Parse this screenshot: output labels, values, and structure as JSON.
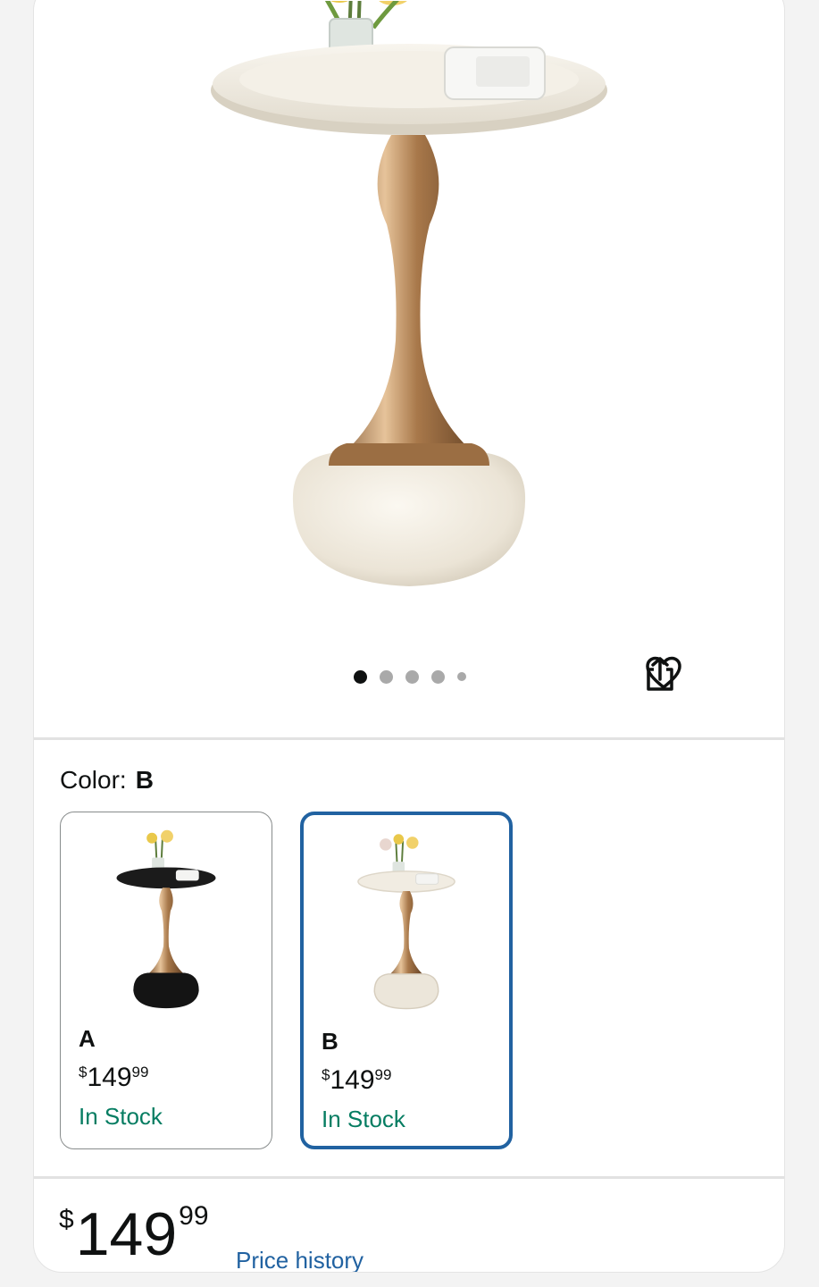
{
  "gallery": {
    "image_count": 5,
    "active_index": 0,
    "actions": [
      "heart-icon",
      "share-icon"
    ]
  },
  "color": {
    "label": "Color:",
    "selected": "B"
  },
  "options": [
    {
      "name": "A",
      "currency": "$",
      "whole": "149",
      "fraction": "99",
      "stock": "In Stock",
      "tabletop": "#1b1b1b",
      "base": "#141414",
      "selected": false
    },
    {
      "name": "B",
      "currency": "$",
      "whole": "149",
      "fraction": "99",
      "stock": "In Stock",
      "tabletop": "#f1ece2",
      "base": "#ece6da",
      "selected": true
    }
  ],
  "price": {
    "currency": "$",
    "whole": "149",
    "fraction": "99",
    "history_label": "Price history"
  },
  "colors": {
    "accent": "#2162a1",
    "in_stock": "#067d62",
    "gold": "#b58a5a"
  }
}
